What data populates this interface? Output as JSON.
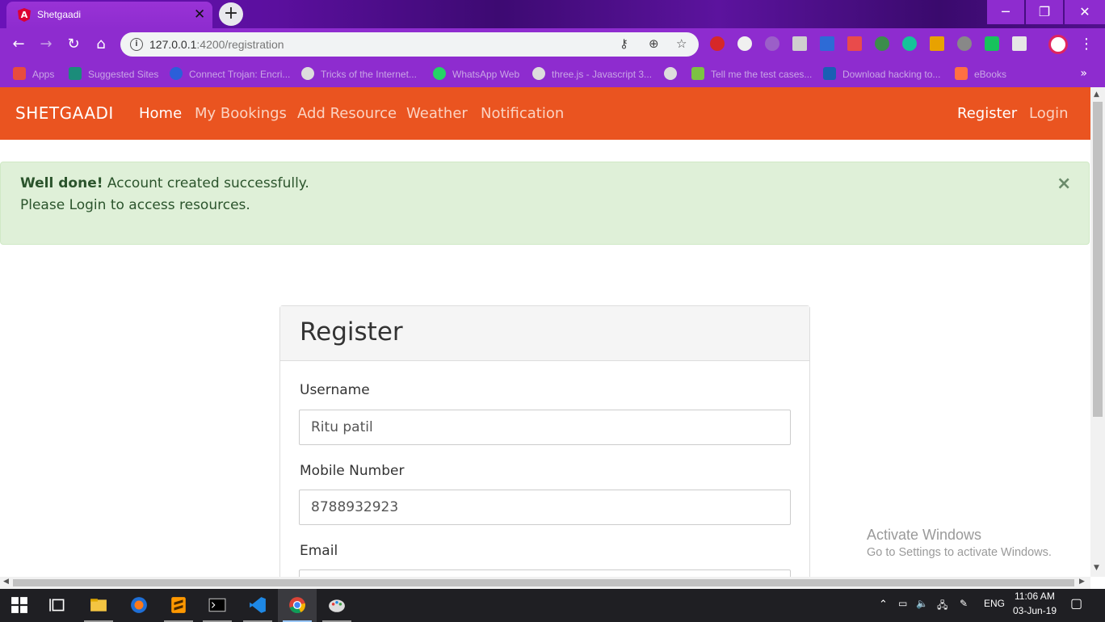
{
  "browser": {
    "tab_title": "Shetgaadi",
    "tab_favicon": "A",
    "url_host": "127.0.0.1",
    "url_path": ":4200/registration",
    "bookmarks": [
      {
        "label": "Apps",
        "color": "#e84c3d"
      },
      {
        "label": "Suggested Sites",
        "color": "#1b8c7a"
      },
      {
        "label": "Connect Trojan: Encri...",
        "color": "#2b5fd9"
      },
      {
        "label": "Tricks of the Internet...",
        "color": "#dddddd"
      },
      {
        "label": "WhatsApp Web",
        "color": "#25d366"
      },
      {
        "label": "three.js - Javascript 3...",
        "color": "#dddddd"
      },
      {
        "label": "",
        "color": "#dddddd"
      },
      {
        "label": "Tell me the test cases...",
        "color": "#7cc242"
      },
      {
        "label": "Download hacking to...",
        "color": "#1a5fb4"
      },
      {
        "label": "eBooks",
        "color": "#ff7043"
      }
    ]
  },
  "app": {
    "brand": "SHETGAADI",
    "nav": {
      "home": "Home",
      "my_bookings": "My Bookings",
      "add_resource": "Add Resource",
      "weather": "Weather",
      "notification": "Notification",
      "register": "Register",
      "login": "Login"
    },
    "alert": {
      "strong": "Well done!",
      "message": " Account created successfully.",
      "line2": "Please Login to access resources.",
      "close": "×"
    },
    "form": {
      "title": "Register",
      "username_label": "Username",
      "username_value": "Ritu patil",
      "mobile_label": "Mobile Number",
      "mobile_value": "8788932923",
      "email_label": "Email"
    }
  },
  "watermark": {
    "line1": "Activate Windows",
    "line2": "Go to Settings to activate Windows."
  },
  "taskbar": {
    "lang": "ENG",
    "time": "11:06 AM",
    "date": "03-Jun-19"
  }
}
